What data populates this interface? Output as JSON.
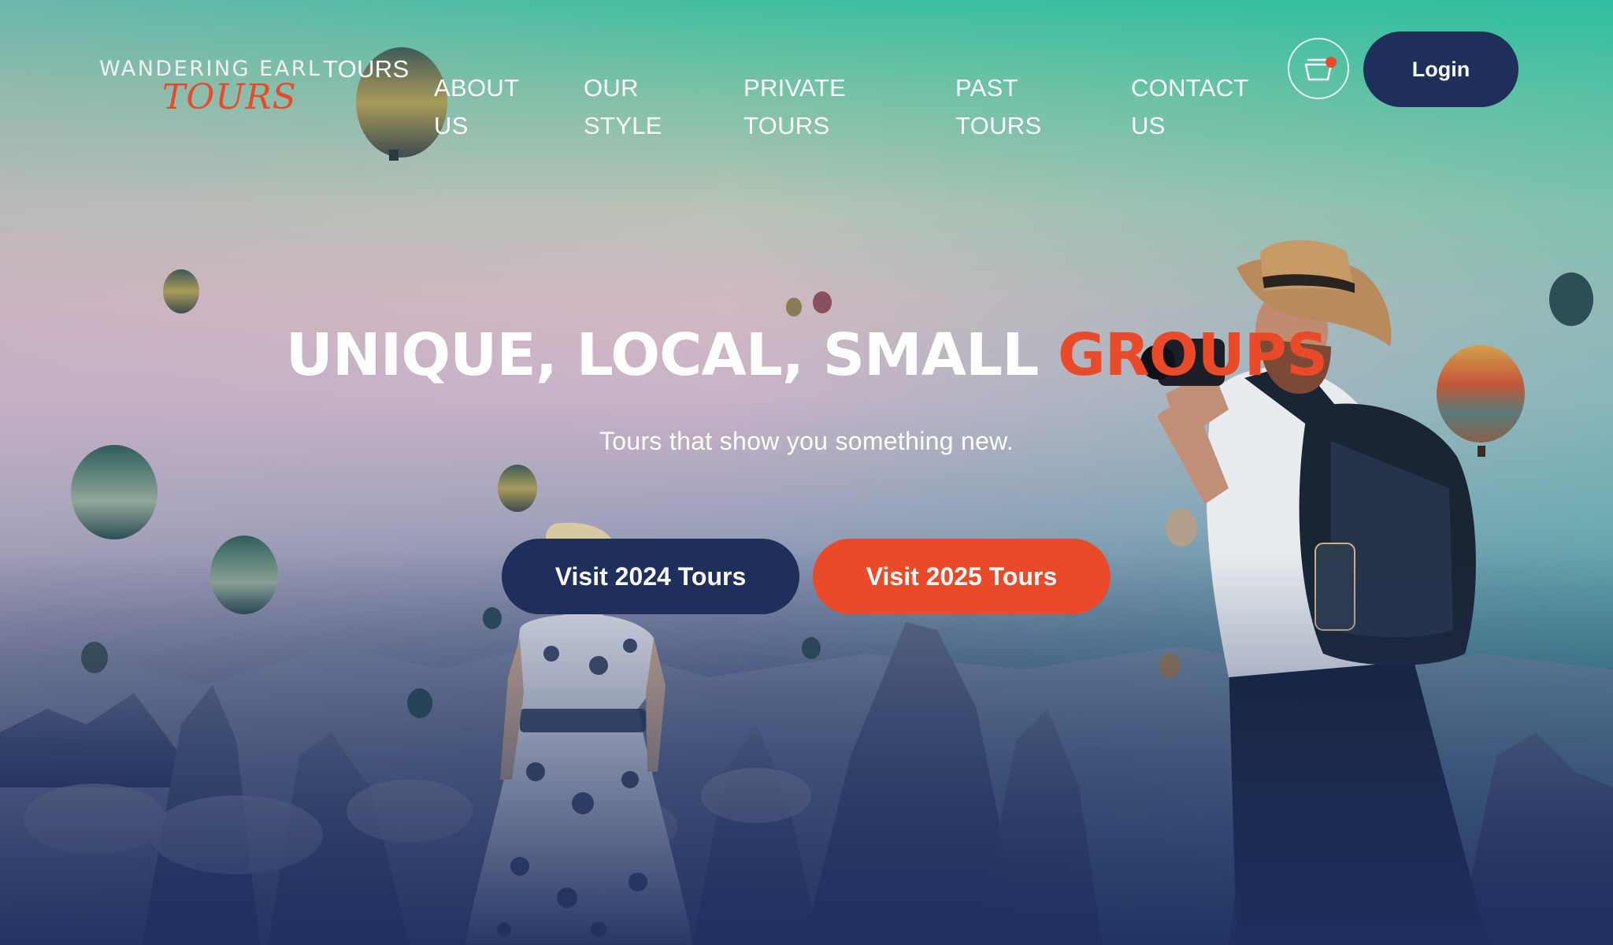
{
  "logo": {
    "line1": "WANDERING EARL",
    "line2": "TOURS"
  },
  "nav": {
    "items": [
      {
        "label": "TOURS"
      },
      {
        "label": "ABOUT\nUS"
      },
      {
        "label": "OUR\nSTYLE"
      },
      {
        "label": "PRIVATE\nTOURS"
      },
      {
        "label": "PAST\nTOURS"
      },
      {
        "label": "CONTACT\nUS"
      }
    ],
    "cart_icon": "shopping-basket-icon",
    "login_label": "Login"
  },
  "hero": {
    "headline_main": "UNIQUE, LOCAL, SMALL ",
    "headline_accent": "GROUPS",
    "subtitle": "Tours that show you something new.",
    "cta_2024": "Visit 2024 Tours",
    "cta_2025": "Visit 2025 Tours"
  },
  "colors": {
    "navy": "#1e2f5a",
    "accent": "#e94a2a",
    "teal": "#3fbf9f"
  }
}
